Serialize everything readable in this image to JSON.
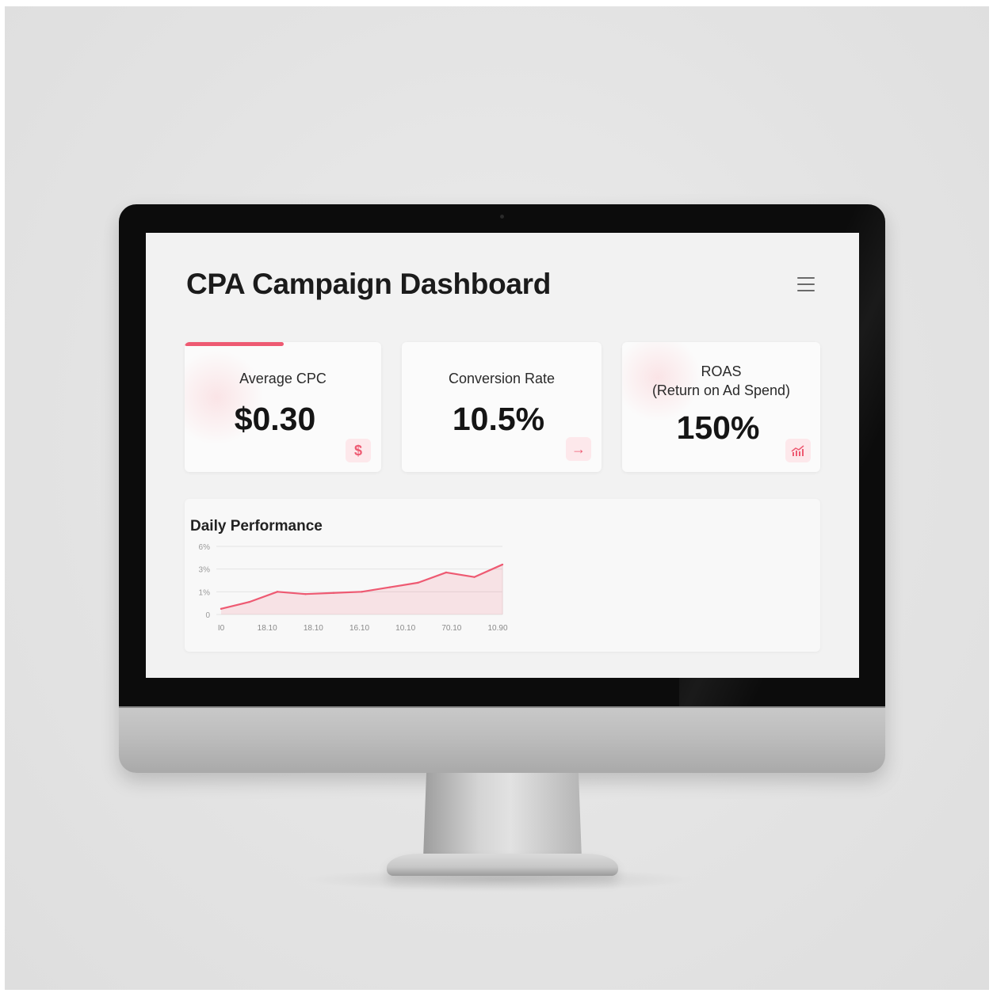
{
  "dashboard": {
    "title": "CPA Campaign Dashboard",
    "menu_icon": "hamburger-menu-icon"
  },
  "cards": [
    {
      "label": "Average CPC",
      "value": "$0.30",
      "icon": "dollar-icon",
      "icon_glyph": "$"
    },
    {
      "label": "Conversion Rate",
      "value": "10.5%",
      "icon": "arrow-right-icon",
      "icon_glyph": "→"
    },
    {
      "label": "ROAS",
      "label_sub": "(Return on Ad Spend)",
      "value": "150%",
      "icon": "bar-chart-trend-icon"
    }
  ],
  "colors": {
    "accent": "#ee5a72",
    "accent_light": "#fde8eb",
    "screen_bg": "#f2f2f2"
  },
  "chart_data": {
    "type": "area",
    "title": "Daily Performance",
    "x": [
      "I0",
      "18.10",
      "18.10",
      "16.10",
      "10.10",
      "70.10",
      "10.90"
    ],
    "y_ticks": [
      "0",
      "1%",
      "3%",
      "6%"
    ],
    "values": [
      0.5,
      1.1,
      2.0,
      1.8,
      1.9,
      2.0,
      2.4,
      2.8,
      3.7,
      3.3,
      4.4
    ],
    "ylim": [
      0,
      6
    ],
    "grid": true
  }
}
